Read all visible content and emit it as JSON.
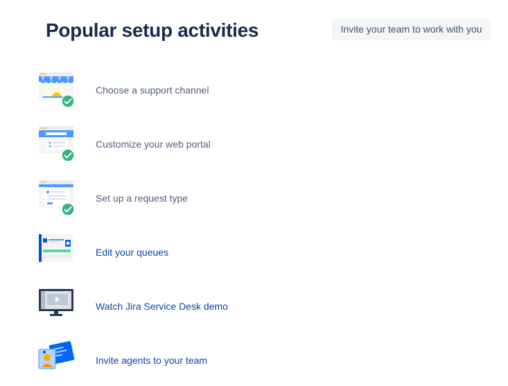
{
  "header": {
    "title": "Popular setup activities",
    "invite_button": "Invite your team to work with you"
  },
  "activities": [
    {
      "label": "Choose a support channel",
      "completed": true,
      "icon": "support-channel-illustration"
    },
    {
      "label": "Customize your web portal",
      "completed": true,
      "icon": "web-portal-illustration"
    },
    {
      "label": "Set up a request type",
      "completed": true,
      "icon": "request-type-illustration"
    },
    {
      "label": "Edit your queues",
      "completed": false,
      "icon": "queues-illustration"
    },
    {
      "label": "Watch Jira Service Desk demo",
      "completed": false,
      "icon": "demo-video-illustration"
    },
    {
      "label": "Invite agents to your team",
      "completed": false,
      "icon": "invite-agents-illustration"
    }
  ],
  "colors": {
    "title": "#172b4d",
    "link": "#0747a6",
    "completed_text": "#505f79",
    "check": "#36b37e",
    "button_bg": "#f4f5f7"
  }
}
